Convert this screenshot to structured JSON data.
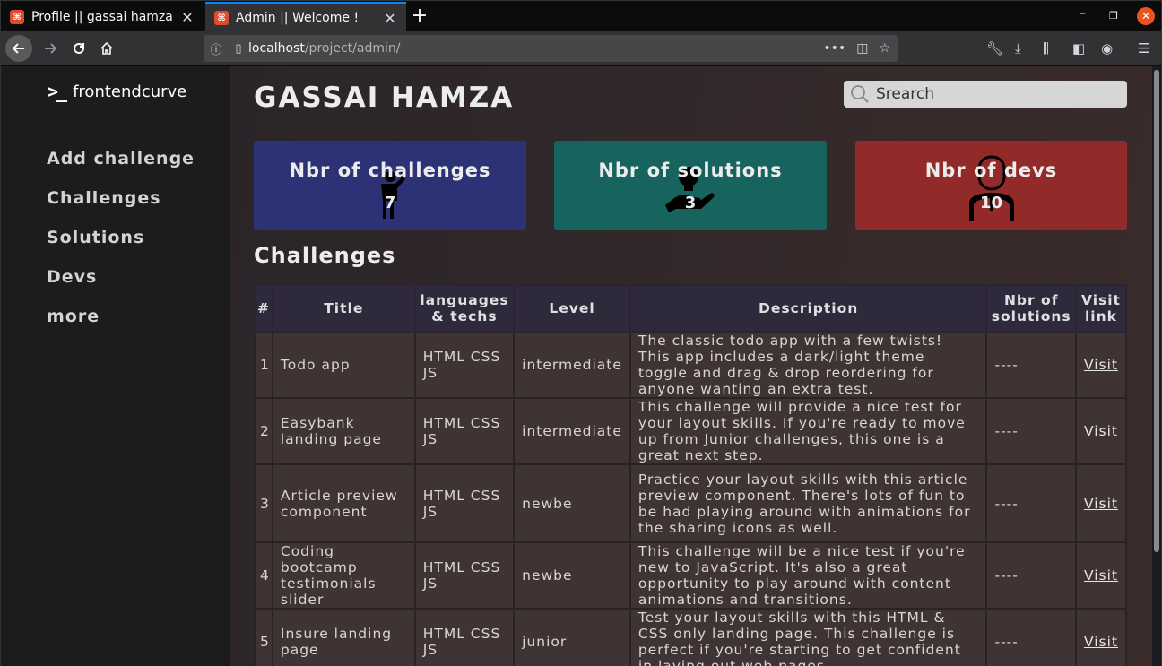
{
  "browser": {
    "tabs": [
      {
        "title": "Profile || gassai hamza",
        "active": false
      },
      {
        "title": "Admin || Welcome !",
        "active": true
      }
    ],
    "url_host": "localhost",
    "url_path": "/project/admin/"
  },
  "sidebar": {
    "logo_mark": ">_",
    "logo_text": "frontendcurve",
    "items": [
      {
        "label": "Add challenge"
      },
      {
        "label": "Challenges"
      },
      {
        "label": "Solutions"
      },
      {
        "label": "Devs"
      },
      {
        "label": "more"
      }
    ]
  },
  "header": {
    "title": "GASSAI HAMZA",
    "search_placeholder": "Srearch"
  },
  "cards": [
    {
      "title": "Nbr of challenges",
      "value": "7",
      "color": "#2c3275",
      "icon": "presenter-icon"
    },
    {
      "title": "Nbr of solutions",
      "value": "3",
      "color": "#17635e",
      "icon": "hand-bulb-icon"
    },
    {
      "title": "Nbr of devs",
      "value": "10",
      "color": "#922a2a",
      "icon": "developer-icon"
    }
  ],
  "section_title": "Challenges",
  "table": {
    "headers": [
      "#",
      "Title",
      "languages & techs",
      "Level",
      "Description",
      "Nbr of solutions",
      "Visit link"
    ],
    "rows": [
      {
        "num": "1",
        "title": "Todo app",
        "techs": "HTML CSS JS",
        "level": "intermediate",
        "description": "The classic todo app with a few twists! This app includes a dark/light theme toggle and drag & drop reordering for anyone wanting an extra test.",
        "solutions": "----",
        "link": "Visit"
      },
      {
        "num": "2",
        "title": "Easybank landing page",
        "techs": "HTML CSS JS",
        "level": "intermediate",
        "description": "This challenge will provide a nice test for your layout skills. If you're ready to move up from Junior challenges, this one is a great next step.",
        "solutions": "----",
        "link": "Visit"
      },
      {
        "num": "3",
        "title": "Article preview component",
        "techs": "HTML CSS JS",
        "level": "newbe",
        "description": "Practice your layout skills with this article preview component. There's lots of fun to be had playing around with animations for the sharing icons as well.",
        "solutions": "----",
        "link": "Visit"
      },
      {
        "num": "4",
        "title": "Coding bootcamp testimonials slider",
        "techs": "HTML CSS JS",
        "level": "newbe",
        "description": "This challenge will be a nice test if you're new to JavaScript. It's also a great opportunity to play around with content animations and transitions.",
        "solutions": "----",
        "link": "Visit"
      },
      {
        "num": "5",
        "title": "Insure landing page",
        "techs": "HTML CSS JS",
        "level": "junior",
        "description": "Test your layout skills with this HTML & CSS only landing page. This challenge is perfect if you're starting to get confident in laying out web pages.",
        "solutions": "----",
        "link": "Visit"
      }
    ]
  }
}
